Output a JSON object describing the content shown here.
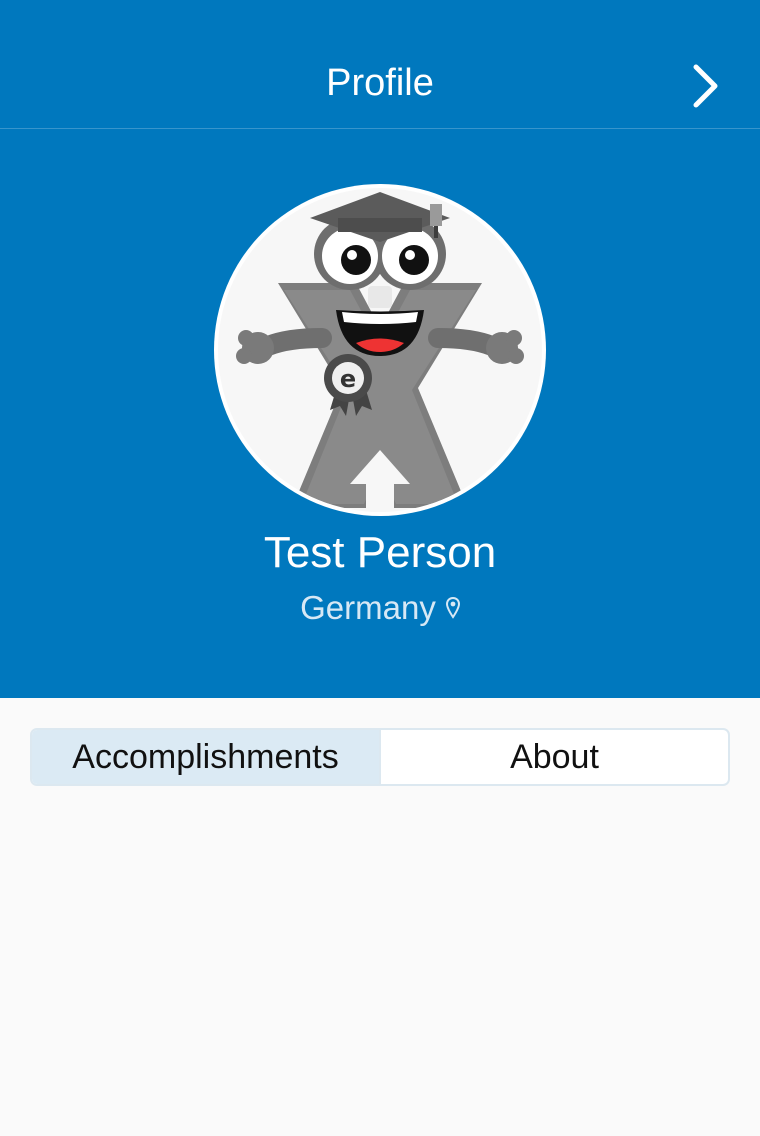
{
  "colors": {
    "accent": "#0078be",
    "background": "#fafafa",
    "segment_active": "#dbeaf4"
  },
  "nav": {
    "title": "Profile",
    "next_icon": "chevron-right-icon"
  },
  "profile": {
    "avatar_icon": "mascot-avatar-icon",
    "name": "Test Person",
    "location": "Germany",
    "location_icon": "map-pin-icon"
  },
  "tabs": [
    {
      "label": "Accomplishments",
      "active": true
    },
    {
      "label": "About",
      "active": false
    }
  ]
}
